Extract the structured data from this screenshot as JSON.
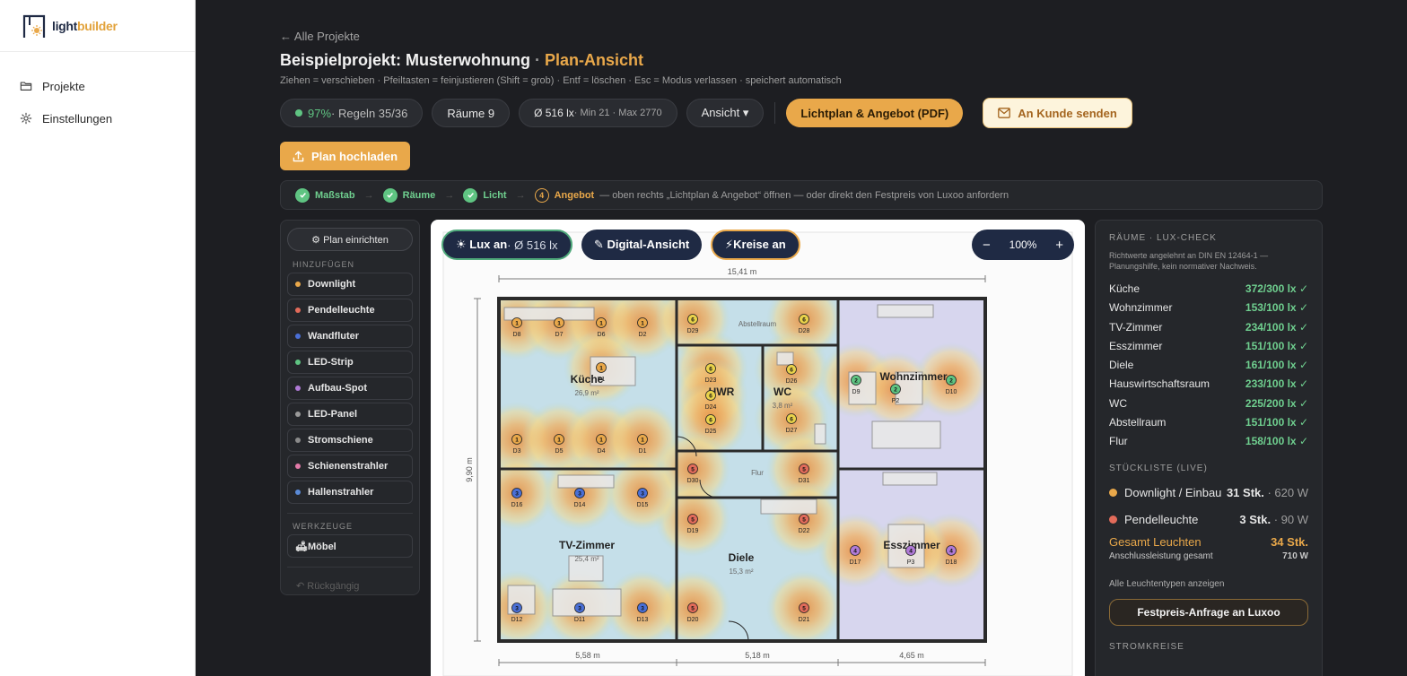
{
  "app": {
    "logo_a": "light",
    "logo_b": "builder"
  },
  "nav": [
    {
      "label": "Projekte"
    },
    {
      "label": "Einstellungen"
    }
  ],
  "header": {
    "back": "← Alle Projekte",
    "title_main": "Beispielprojekt: Musterwohnung",
    "title_sep": " · ",
    "title_accent": "Plan-Ansicht",
    "hint": "Ziehen = verschieben · Pfeiltasten = feinjustieren (Shift = grob) · Entf = löschen · Esc = Modus verlassen · speichert automatisch"
  },
  "toolbar": {
    "score_pct": "97%",
    "score_rules": " · Regeln 35/36",
    "rooms": "Räume 9",
    "lux_avg": "Ø 516 lx",
    "lux_minmax": " · Min 21 · Max 2770",
    "view": "Ansicht ▾",
    "pdf_btn": "Lichtplan & Angebot (PDF)",
    "send_btn": "An Kunde senden"
  },
  "upload_btn": "Plan hochladen",
  "steps": {
    "s1": "Maßstab",
    "s2": "Räume",
    "s3": "Licht",
    "s4_num": "4",
    "s4": "Angebot",
    "note": "— oben rechts „Lichtplan & Angebot“ öffnen — oder direkt den Festpreis von Luxoo anfordern"
  },
  "tools": {
    "plan_btn": "⚙ Plan einrichten",
    "add_heading": "HINZUFÜGEN",
    "items": [
      {
        "label": "Downlight",
        "color": "#e9a84a"
      },
      {
        "label": "Pendelleuchte",
        "color": "#e26b5a"
      },
      {
        "label": "Wandfluter",
        "color": "#4a6fd6"
      },
      {
        "label": "LED-Strip",
        "color": "#5fc482"
      },
      {
        "label": "Aufbau-Spot",
        "color": "#b07ad6"
      },
      {
        "label": "LED-Panel",
        "color": "#9a9a9a"
      },
      {
        "label": "Stromschiene",
        "color": "#8a8a8a"
      },
      {
        "label": "Schienenstrahler",
        "color": "#e27aa8"
      },
      {
        "label": "Hallenstrahler",
        "color": "#5a8ad6"
      }
    ],
    "tools_heading": "WERKZEUGE",
    "furniture": "🛋Möbel",
    "undo": "↶ Rückgängig"
  },
  "canvas": {
    "lux_toggle": "☀ Lux an",
    "lux_avg": " · Ø 516 lx",
    "digital": "✎ Digital-Ansicht",
    "circuits": "⚡Kreise an",
    "zoom": "100%",
    "zoom_minus": "−",
    "zoom_plus": "+",
    "dims": {
      "top": "15,41 m",
      "left": "9,90 m",
      "b1": "5,58 m",
      "b2": "5,18 m",
      "b3": "4,65 m"
    },
    "rooms": [
      {
        "name": "Küche",
        "area": "26,9 m²"
      },
      {
        "name": "HWR",
        "area": ""
      },
      {
        "name": "WC",
        "area": "3,8 m²"
      },
      {
        "name": "Wohnzimmer",
        "area": ""
      },
      {
        "name": "Abstellraum",
        "area": ""
      },
      {
        "name": "Flur",
        "area": ""
      },
      {
        "name": "TV-Zimmer",
        "area": "25,4 m²"
      },
      {
        "name": "Diele",
        "area": "15,3 m²"
      },
      {
        "name": "Esszimmer",
        "area": ""
      }
    ]
  },
  "right": {
    "lux_heading": "RÄUME · LUX-CHECK",
    "lux_note": "Richtwerte angelehnt an DIN EN 12464-1 — Planungshilfe, kein normativer Nachweis.",
    "lux": [
      {
        "room": "Küche",
        "value": "372/300 lx ✓"
      },
      {
        "room": "Wohnzimmer",
        "value": "153/100 lx ✓"
      },
      {
        "room": "TV-Zimmer",
        "value": "234/100 lx ✓"
      },
      {
        "room": "Esszimmer",
        "value": "151/100 lx ✓"
      },
      {
        "room": "Diele",
        "value": "161/100 lx ✓"
      },
      {
        "room": "Hauswirtschaftsraum",
        "value": "233/100 lx ✓"
      },
      {
        "room": "WC",
        "value": "225/200 lx ✓"
      },
      {
        "room": "Abstellraum",
        "value": "151/100 lx ✓"
      },
      {
        "room": "Flur",
        "value": "158/100 lx ✓"
      }
    ],
    "bom_heading": "STÜCKLISTE (LIVE)",
    "bom": [
      {
        "name": "Downlight / Einbau",
        "qty": "31 Stk.",
        "watt": " · 620 W",
        "color": "#e9a84a"
      },
      {
        "name": "Pendelleuchte",
        "qty": "3 Stk.",
        "watt": " · 90 W",
        "color": "#e26b5a"
      }
    ],
    "total_label": "Gesamt Leuchten",
    "total_value": "34 Stk.",
    "conn_label": "Anschlussleistung gesamt",
    "conn_value": "710 W",
    "all_types": "Alle Leuchtentypen anzeigen",
    "festpreis": "Festpreis-Anfrage an Luxoo",
    "next_heading": "STROMKREISE"
  }
}
